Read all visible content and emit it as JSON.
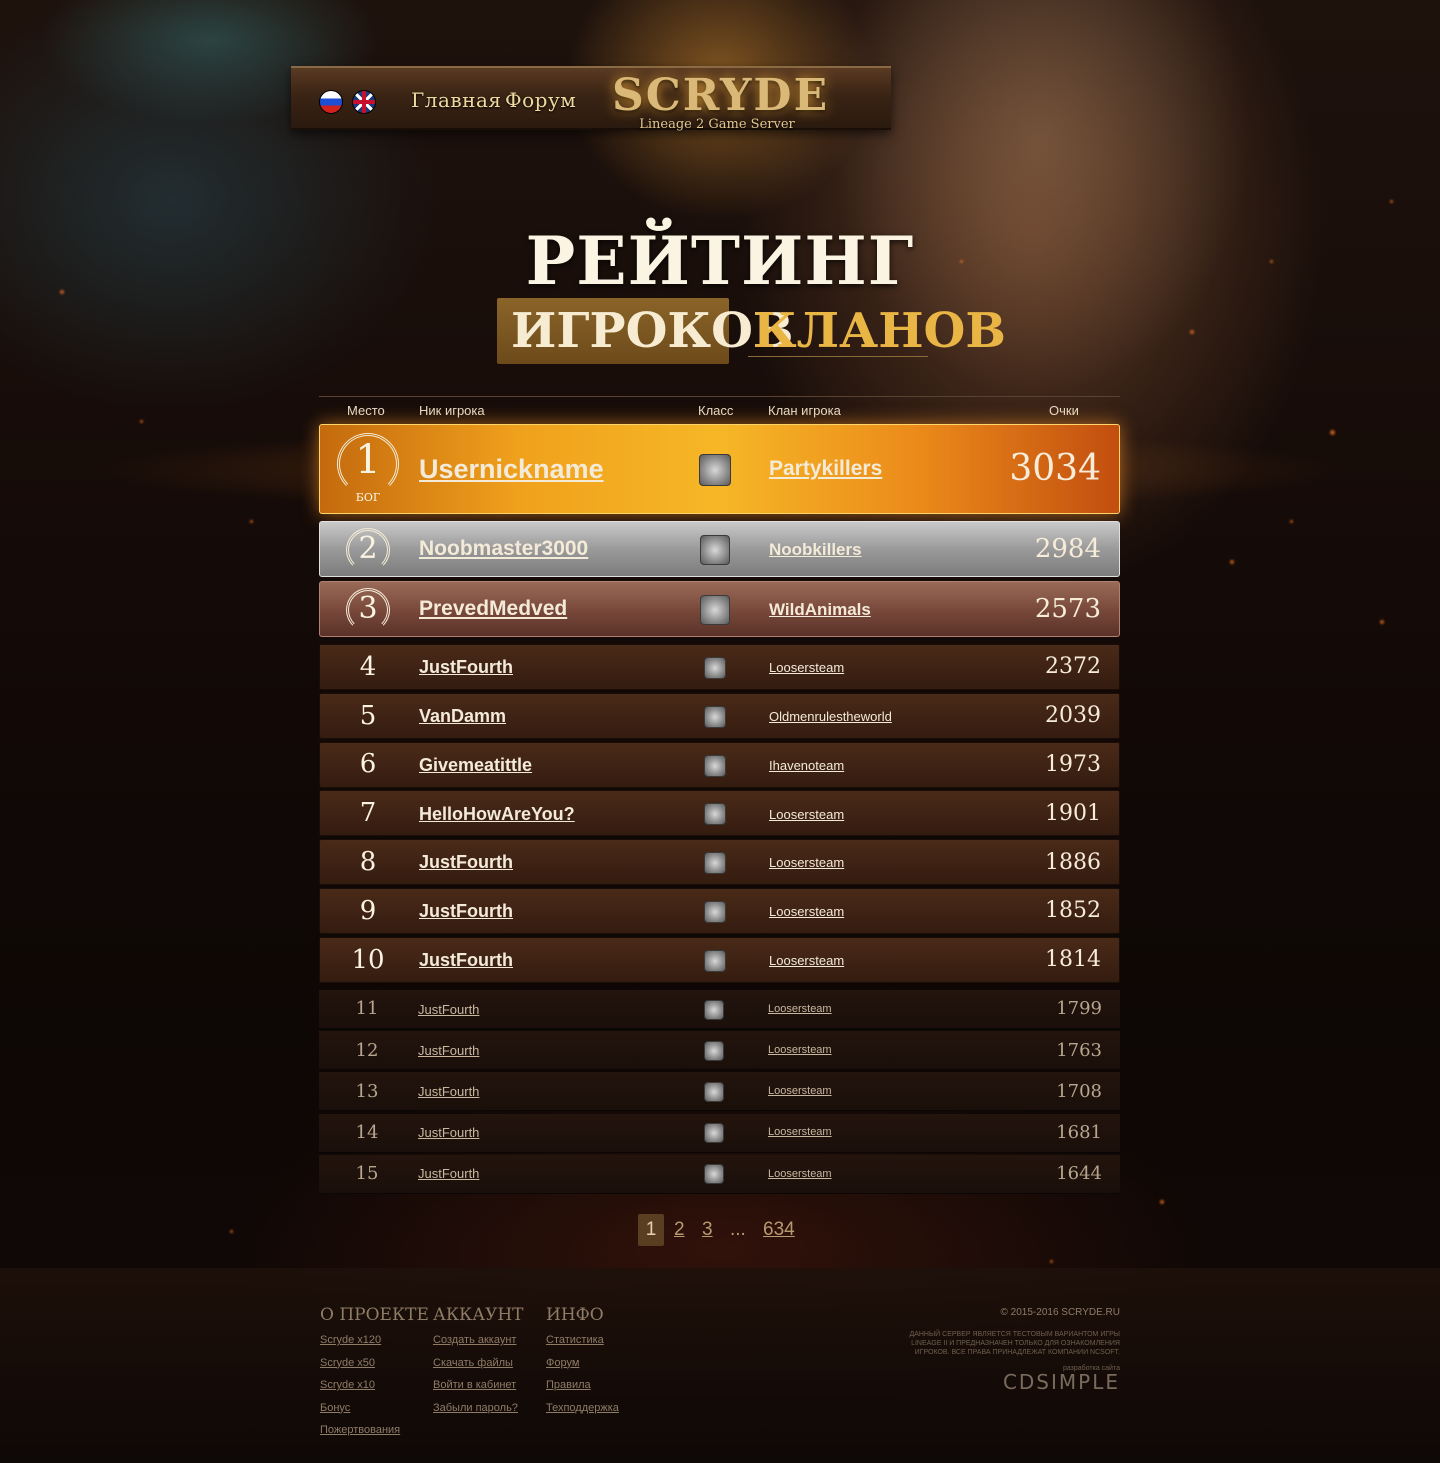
{
  "header": {
    "logo": "SCRYDE",
    "logo_subtitle": "Lineage 2 Game Server",
    "nav": [
      "Главная",
      "Форум"
    ]
  },
  "title": "РЕЙТИНГ",
  "tabs": {
    "players": "ИГРОКОВ",
    "clans": "КЛАНОВ",
    "active": "players"
  },
  "table": {
    "headers": {
      "place": "Место",
      "nick": "Ник игрока",
      "class": "Класс",
      "clan": "Клан игрока",
      "points": "Очки"
    },
    "top_title": "БОГ",
    "rows": [
      {
        "rank": "1",
        "nick": "Usernickname",
        "clan": "Partykillers",
        "points": "3034"
      },
      {
        "rank": "2",
        "nick": "Noobmaster3000",
        "clan": "Noobkillers",
        "points": "2984"
      },
      {
        "rank": "3",
        "nick": "PrevedMedved",
        "clan": "WildAnimals",
        "points": "2573"
      },
      {
        "rank": "4",
        "nick": "JustFourth",
        "clan": "Loosersteam",
        "points": "2372"
      },
      {
        "rank": "5",
        "nick": "VanDamm",
        "clan": "Oldmenrulestheworld",
        "points": "2039"
      },
      {
        "rank": "6",
        "nick": "Givemeatittle",
        "clan": "Ihavenoteam",
        "points": "1973"
      },
      {
        "rank": "7",
        "nick": "HelloHowAreYou?",
        "clan": "Loosersteam",
        "points": "1901"
      },
      {
        "rank": "8",
        "nick": "JustFourth",
        "clan": "Loosersteam",
        "points": "1886"
      },
      {
        "rank": "9",
        "nick": "JustFourth",
        "clan": "Loosersteam",
        "points": "1852"
      },
      {
        "rank": "10",
        "nick": "JustFourth",
        "clan": "Loosersteam",
        "points": "1814"
      },
      {
        "rank": "11",
        "nick": "JustFourth",
        "clan": "Loosersteam",
        "points": "1799"
      },
      {
        "rank": "12",
        "nick": "JustFourth",
        "clan": "Loosersteam",
        "points": "1763"
      },
      {
        "rank": "13",
        "nick": "JustFourth",
        "clan": "Loosersteam",
        "points": "1708"
      },
      {
        "rank": "14",
        "nick": "JustFourth",
        "clan": "Loosersteam",
        "points": "1681"
      },
      {
        "rank": "15",
        "nick": "JustFourth",
        "clan": "Loosersteam",
        "points": "1644"
      }
    ]
  },
  "pagination": {
    "pages": [
      "1",
      "2",
      "3"
    ],
    "ellipsis": "...",
    "last": "634",
    "current": "1"
  },
  "footer": {
    "columns": [
      {
        "title": "О ПРОЕКТЕ",
        "links": [
          "Scryde x120",
          "Scryde x50",
          "Scryde x10",
          "Бонус",
          "Пожертвования"
        ]
      },
      {
        "title": "АККАУНТ",
        "links": [
          "Создать аккаунт",
          "Скачать файлы",
          "Войти в кабинет",
          "Забыли пароль?"
        ]
      },
      {
        "title": "ИНФО",
        "links": [
          "Статистика",
          "Форум",
          "Правила",
          "Техподдержка"
        ]
      }
    ],
    "copyright": "© 2015-2016 SCRYDE.RU",
    "disclaimer": "ДАННЫЙ СЕРВЕР ЯВЛЯЕТСЯ ТЕСТОВЫМ ВАРИАНТОМ ИГРЫ LINEAGE II И ПРЕДНАЗНАЧЕН ТОЛЬКО ДЛЯ ОЗНАКОМЛЕНИЯ ИГРОКОВ. ВСЕ ПРАВА ПРИНАДЛЕЖАТ КОМПАНИИ NCSOFT.",
    "developer_label": "разработка сайта",
    "developer_logo": "CDSIMPLE"
  }
}
